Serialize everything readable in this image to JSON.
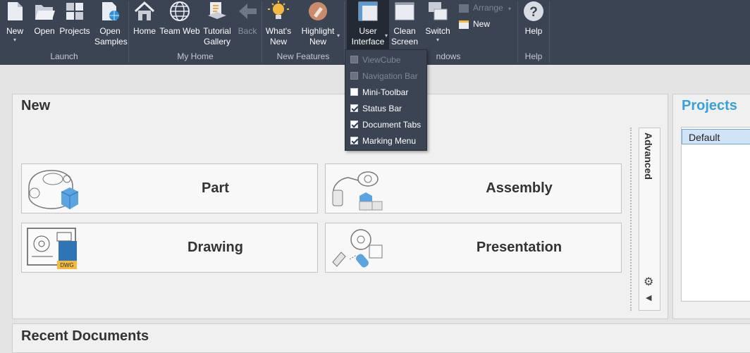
{
  "ribbon": {
    "launch": {
      "group_label": "Launch",
      "new": "New",
      "open": "Open",
      "projects": "Projects",
      "open_samples": "Open Samples"
    },
    "my_home": {
      "group_label": "My Home",
      "home": "Home",
      "team_web": "Team Web",
      "tutorial_gallery": "Tutorial Gallery",
      "back": "Back"
    },
    "new_features": {
      "group_label": "New Features",
      "whats_new": "What's New",
      "highlight_new": "Highlight New"
    },
    "windows": {
      "group_label_visible": "ndows",
      "user_interface": "User Interface",
      "clean_screen": "Clean Screen",
      "switch": "Switch",
      "arrange": "Arrange",
      "new": "New"
    },
    "help": {
      "group_label": "Help",
      "help": "Help"
    }
  },
  "ui_menu": {
    "items": [
      {
        "label": "ViewCube",
        "checked": false,
        "enabled": false
      },
      {
        "label": "Navigation Bar",
        "checked": false,
        "enabled": false
      },
      {
        "label": "Mini-Toolbar",
        "checked": false,
        "enabled": true
      },
      {
        "label": "Status Bar",
        "checked": true,
        "enabled": true
      },
      {
        "label": "Document Tabs",
        "checked": true,
        "enabled": true
      },
      {
        "label": "Marking Menu",
        "checked": true,
        "enabled": true
      }
    ]
  },
  "new_panel": {
    "title": "New",
    "tiles": {
      "part": "Part",
      "assembly": "Assembly",
      "drawing": "Drawing",
      "presentation": "Presentation"
    },
    "dwg_badge": "DWG",
    "advanced": "Advanced"
  },
  "projects_panel": {
    "title": "Projects",
    "items": [
      "Default"
    ]
  },
  "recent_panel": {
    "title": "Recent Documents"
  },
  "colors": {
    "ribbon_bg": "#3b4453",
    "accent_blue": "#3aa0d8",
    "page_bg": "#e4e4e4"
  }
}
